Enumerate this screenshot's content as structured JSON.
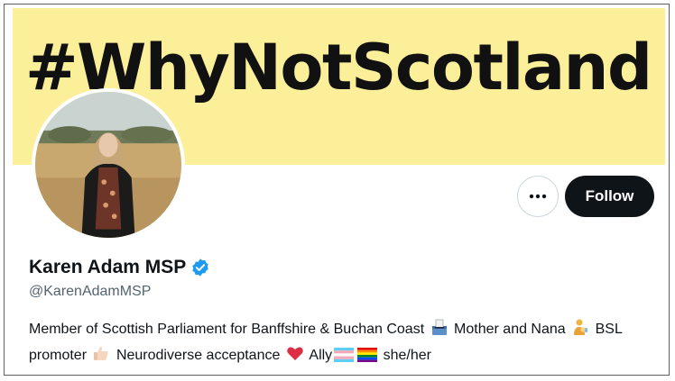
{
  "banner": {
    "text": "#WhyNotScotland"
  },
  "profile": {
    "name": "Karen Adam MSP",
    "handle": "@KarenAdamMSP",
    "verified_icon": "verified-badge-icon"
  },
  "actions": {
    "more_icon": "more-options-icon",
    "follow_label": "Follow"
  },
  "bio": {
    "part1": "Member of Scottish Parliament for Banffshire & Buchan Coast",
    "part2": "Mother and Nana",
    "part3": "BSL promoter",
    "part4": "Neurodiverse acceptance",
    "part5": "Ally",
    "part6": "she/her",
    "icons": [
      "ballot-box-icon",
      "person-feeding-baby-icon",
      "thumbs-up-icon",
      "red-heart-icon",
      "trans-flag-icon",
      "rainbow-flag-icon"
    ]
  },
  "colors": {
    "banner_bg": "#fbef9a",
    "follow_bg": "#0f1419",
    "verified": "#1d9bf0",
    "handle_text": "#536471"
  }
}
